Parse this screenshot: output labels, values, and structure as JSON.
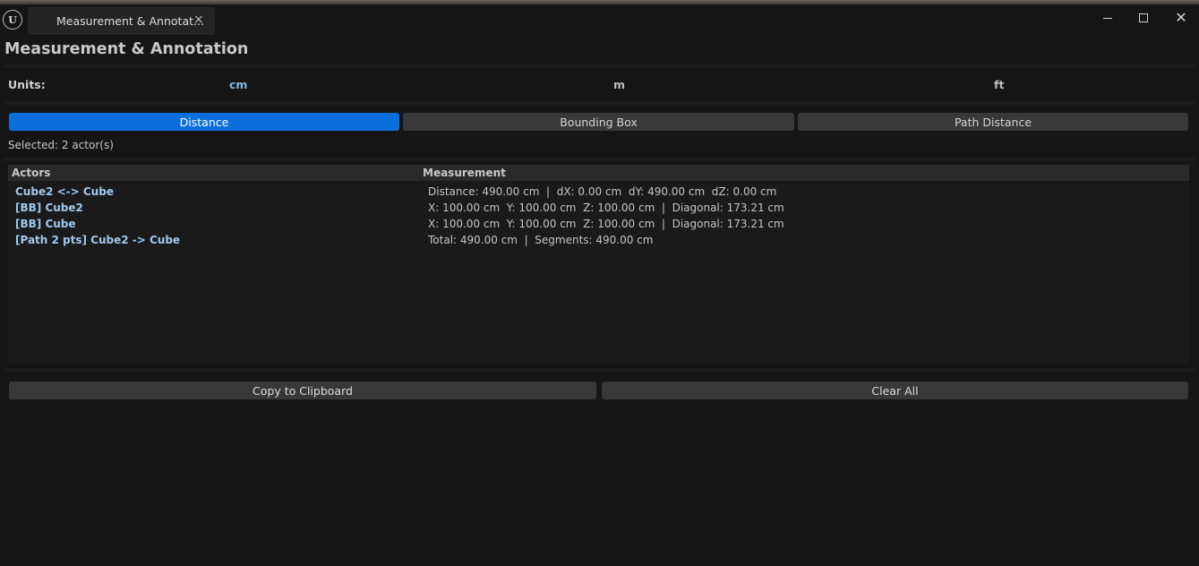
{
  "window": {
    "tab_title": "Measurement & Annotat...",
    "tab_close": "×",
    "logo_text": "U",
    "close_glyph": "✕"
  },
  "page": {
    "title": "Measurement & Annotation"
  },
  "units": {
    "label": "Units:",
    "options": [
      "cm",
      "m",
      "ft"
    ],
    "selected": "cm"
  },
  "modes": {
    "items": [
      "Distance",
      "Bounding Box",
      "Path Distance"
    ],
    "active": "Distance"
  },
  "selection": {
    "text": "Selected: 2 actor(s)"
  },
  "table": {
    "columns": [
      "Actors",
      "Measurement"
    ],
    "rows": [
      {
        "actor": "Cube2 <-> Cube",
        "measurement": "Distance: 490.00 cm  |  dX: 0.00 cm  dY: 490.00 cm  dZ: 0.00 cm"
      },
      {
        "actor": "[BB] Cube2",
        "measurement": "X: 100.00 cm  Y: 100.00 cm  Z: 100.00 cm  |  Diagonal: 173.21 cm"
      },
      {
        "actor": "[BB] Cube",
        "measurement": "X: 100.00 cm  Y: 100.00 cm  Z: 100.00 cm  |  Diagonal: 173.21 cm"
      },
      {
        "actor": "[Path 2 pts] Cube2 -> Cube",
        "measurement": "Total: 490.00 cm  |  Segments: 490.00 cm"
      }
    ]
  },
  "actions": {
    "copy_label": "Copy to Clipboard",
    "clear_label": "Clear All"
  },
  "colors": {
    "accent": "#0a6fdc",
    "actor_text": "#9ec9ef",
    "active_unit": "#7fb8e6",
    "background": "#151515"
  }
}
